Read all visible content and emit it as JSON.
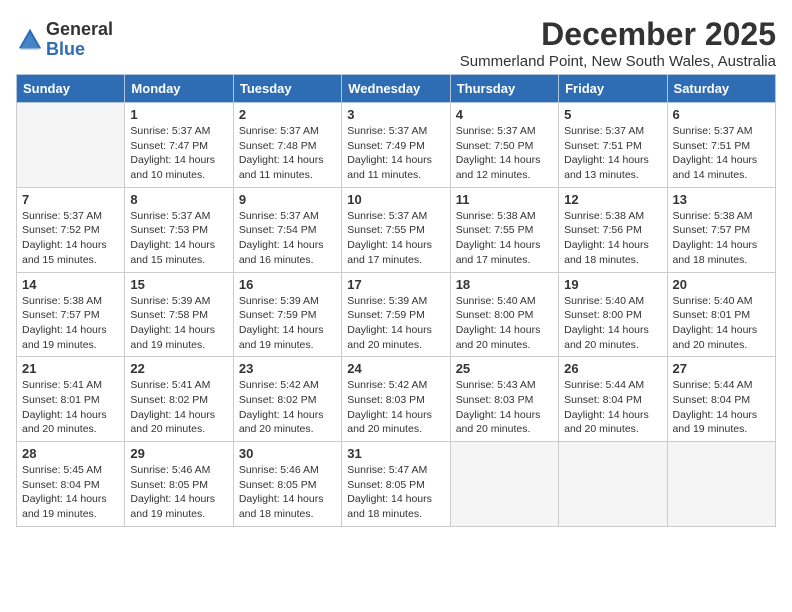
{
  "header": {
    "logo_general": "General",
    "logo_blue": "Blue",
    "main_title": "December 2025",
    "sub_title": "Summerland Point, New South Wales, Australia"
  },
  "calendar": {
    "weekdays": [
      "Sunday",
      "Monday",
      "Tuesday",
      "Wednesday",
      "Thursday",
      "Friday",
      "Saturday"
    ],
    "weeks": [
      [
        {
          "day": "",
          "sunrise": "",
          "sunset": "",
          "daylight": ""
        },
        {
          "day": "1",
          "sunrise": "Sunrise: 5:37 AM",
          "sunset": "Sunset: 7:47 PM",
          "daylight": "Daylight: 14 hours and 10 minutes."
        },
        {
          "day": "2",
          "sunrise": "Sunrise: 5:37 AM",
          "sunset": "Sunset: 7:48 PM",
          "daylight": "Daylight: 14 hours and 11 minutes."
        },
        {
          "day": "3",
          "sunrise": "Sunrise: 5:37 AM",
          "sunset": "Sunset: 7:49 PM",
          "daylight": "Daylight: 14 hours and 11 minutes."
        },
        {
          "day": "4",
          "sunrise": "Sunrise: 5:37 AM",
          "sunset": "Sunset: 7:50 PM",
          "daylight": "Daylight: 14 hours and 12 minutes."
        },
        {
          "day": "5",
          "sunrise": "Sunrise: 5:37 AM",
          "sunset": "Sunset: 7:51 PM",
          "daylight": "Daylight: 14 hours and 13 minutes."
        },
        {
          "day": "6",
          "sunrise": "Sunrise: 5:37 AM",
          "sunset": "Sunset: 7:51 PM",
          "daylight": "Daylight: 14 hours and 14 minutes."
        }
      ],
      [
        {
          "day": "7",
          "sunrise": "Sunrise: 5:37 AM",
          "sunset": "Sunset: 7:52 PM",
          "daylight": "Daylight: 14 hours and 15 minutes."
        },
        {
          "day": "8",
          "sunrise": "Sunrise: 5:37 AM",
          "sunset": "Sunset: 7:53 PM",
          "daylight": "Daylight: 14 hours and 15 minutes."
        },
        {
          "day": "9",
          "sunrise": "Sunrise: 5:37 AM",
          "sunset": "Sunset: 7:54 PM",
          "daylight": "Daylight: 14 hours and 16 minutes."
        },
        {
          "day": "10",
          "sunrise": "Sunrise: 5:37 AM",
          "sunset": "Sunset: 7:55 PM",
          "daylight": "Daylight: 14 hours and 17 minutes."
        },
        {
          "day": "11",
          "sunrise": "Sunrise: 5:38 AM",
          "sunset": "Sunset: 7:55 PM",
          "daylight": "Daylight: 14 hours and 17 minutes."
        },
        {
          "day": "12",
          "sunrise": "Sunrise: 5:38 AM",
          "sunset": "Sunset: 7:56 PM",
          "daylight": "Daylight: 14 hours and 18 minutes."
        },
        {
          "day": "13",
          "sunrise": "Sunrise: 5:38 AM",
          "sunset": "Sunset: 7:57 PM",
          "daylight": "Daylight: 14 hours and 18 minutes."
        }
      ],
      [
        {
          "day": "14",
          "sunrise": "Sunrise: 5:38 AM",
          "sunset": "Sunset: 7:57 PM",
          "daylight": "Daylight: 14 hours and 19 minutes."
        },
        {
          "day": "15",
          "sunrise": "Sunrise: 5:39 AM",
          "sunset": "Sunset: 7:58 PM",
          "daylight": "Daylight: 14 hours and 19 minutes."
        },
        {
          "day": "16",
          "sunrise": "Sunrise: 5:39 AM",
          "sunset": "Sunset: 7:59 PM",
          "daylight": "Daylight: 14 hours and 19 minutes."
        },
        {
          "day": "17",
          "sunrise": "Sunrise: 5:39 AM",
          "sunset": "Sunset: 7:59 PM",
          "daylight": "Daylight: 14 hours and 20 minutes."
        },
        {
          "day": "18",
          "sunrise": "Sunrise: 5:40 AM",
          "sunset": "Sunset: 8:00 PM",
          "daylight": "Daylight: 14 hours and 20 minutes."
        },
        {
          "day": "19",
          "sunrise": "Sunrise: 5:40 AM",
          "sunset": "Sunset: 8:00 PM",
          "daylight": "Daylight: 14 hours and 20 minutes."
        },
        {
          "day": "20",
          "sunrise": "Sunrise: 5:40 AM",
          "sunset": "Sunset: 8:01 PM",
          "daylight": "Daylight: 14 hours and 20 minutes."
        }
      ],
      [
        {
          "day": "21",
          "sunrise": "Sunrise: 5:41 AM",
          "sunset": "Sunset: 8:01 PM",
          "daylight": "Daylight: 14 hours and 20 minutes."
        },
        {
          "day": "22",
          "sunrise": "Sunrise: 5:41 AM",
          "sunset": "Sunset: 8:02 PM",
          "daylight": "Daylight: 14 hours and 20 minutes."
        },
        {
          "day": "23",
          "sunrise": "Sunrise: 5:42 AM",
          "sunset": "Sunset: 8:02 PM",
          "daylight": "Daylight: 14 hours and 20 minutes."
        },
        {
          "day": "24",
          "sunrise": "Sunrise: 5:42 AM",
          "sunset": "Sunset: 8:03 PM",
          "daylight": "Daylight: 14 hours and 20 minutes."
        },
        {
          "day": "25",
          "sunrise": "Sunrise: 5:43 AM",
          "sunset": "Sunset: 8:03 PM",
          "daylight": "Daylight: 14 hours and 20 minutes."
        },
        {
          "day": "26",
          "sunrise": "Sunrise: 5:44 AM",
          "sunset": "Sunset: 8:04 PM",
          "daylight": "Daylight: 14 hours and 20 minutes."
        },
        {
          "day": "27",
          "sunrise": "Sunrise: 5:44 AM",
          "sunset": "Sunset: 8:04 PM",
          "daylight": "Daylight: 14 hours and 19 minutes."
        }
      ],
      [
        {
          "day": "28",
          "sunrise": "Sunrise: 5:45 AM",
          "sunset": "Sunset: 8:04 PM",
          "daylight": "Daylight: 14 hours and 19 minutes."
        },
        {
          "day": "29",
          "sunrise": "Sunrise: 5:46 AM",
          "sunset": "Sunset: 8:05 PM",
          "daylight": "Daylight: 14 hours and 19 minutes."
        },
        {
          "day": "30",
          "sunrise": "Sunrise: 5:46 AM",
          "sunset": "Sunset: 8:05 PM",
          "daylight": "Daylight: 14 hours and 18 minutes."
        },
        {
          "day": "31",
          "sunrise": "Sunrise: 5:47 AM",
          "sunset": "Sunset: 8:05 PM",
          "daylight": "Daylight: 14 hours and 18 minutes."
        },
        {
          "day": "",
          "sunrise": "",
          "sunset": "",
          "daylight": ""
        },
        {
          "day": "",
          "sunrise": "",
          "sunset": "",
          "daylight": ""
        },
        {
          "day": "",
          "sunrise": "",
          "sunset": "",
          "daylight": ""
        }
      ]
    ]
  }
}
